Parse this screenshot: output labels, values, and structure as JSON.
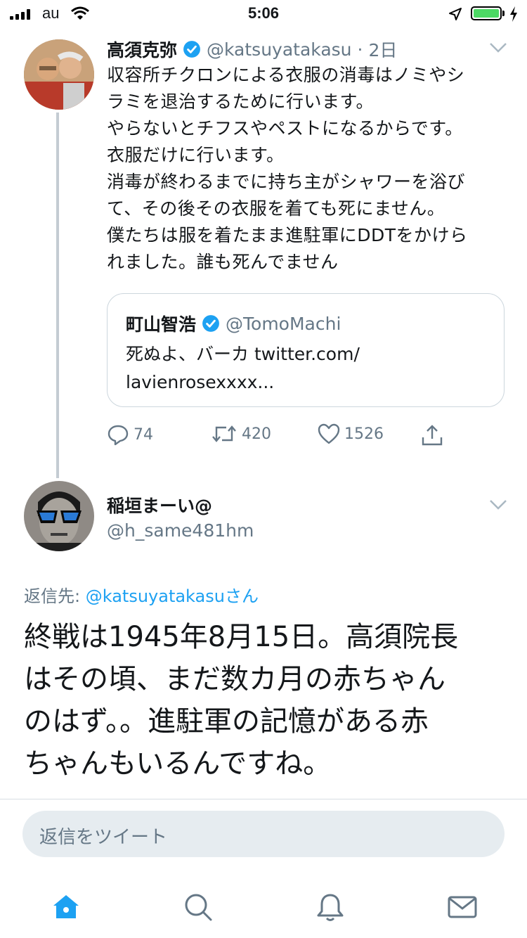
{
  "status_bar": {
    "carrier": "au",
    "time": "5:06",
    "battery_level": 1.0
  },
  "main_tweet": {
    "author_name": "高須克弥",
    "handle": "@katsuyatakasu",
    "dot": "·",
    "age": "2日",
    "text": "収容所チクロンによる衣服の消毒はノミやシ\nラミを退治するために行います。\nやらないとチフスやペストになるからです。\n衣服だけに行います。\n消毒が終わるまでに持ち主がシャワーを浴び\nて、その後その衣服を着ても死にません。\n僕たちは服を着たまま進駐軍にDDTをかけら\nれました。誰も死んでません",
    "quote": {
      "author_name": "町山智浩",
      "handle": "@TomoMachi",
      "text": "死ぬよ、バーカ twitter.com/\nlavienrosexxxx..."
    },
    "replies": "74",
    "retweets": "420",
    "likes": "1526"
  },
  "reply_tweet": {
    "author_name": "稲垣まーい@",
    "handle": "@h_same481hm",
    "reply_to_label": "返信先: ",
    "reply_to_mention": "@katsuyatakasu",
    "reply_to_suffix": "さん",
    "text": "終戦は1945年8月15日。高須院長\nはその頃、まだ数カ月の赤ちゃん\nのはず。。進駐軍の記憶がある赤\nちゃんもいるんですね。"
  },
  "composer": {
    "placeholder": "返信をツイート"
  },
  "colors": {
    "accent": "#1da1f2",
    "secondary_text": "#657786",
    "battery": "#4cd964"
  },
  "icons": [
    "signal-icon",
    "wifi-icon",
    "location-icon",
    "battery-icon",
    "verified-icon",
    "chevron-down-icon",
    "reply-icon",
    "retweet-icon",
    "like-icon",
    "share-icon",
    "home-icon",
    "search-icon",
    "notifications-icon",
    "messages-icon"
  ]
}
